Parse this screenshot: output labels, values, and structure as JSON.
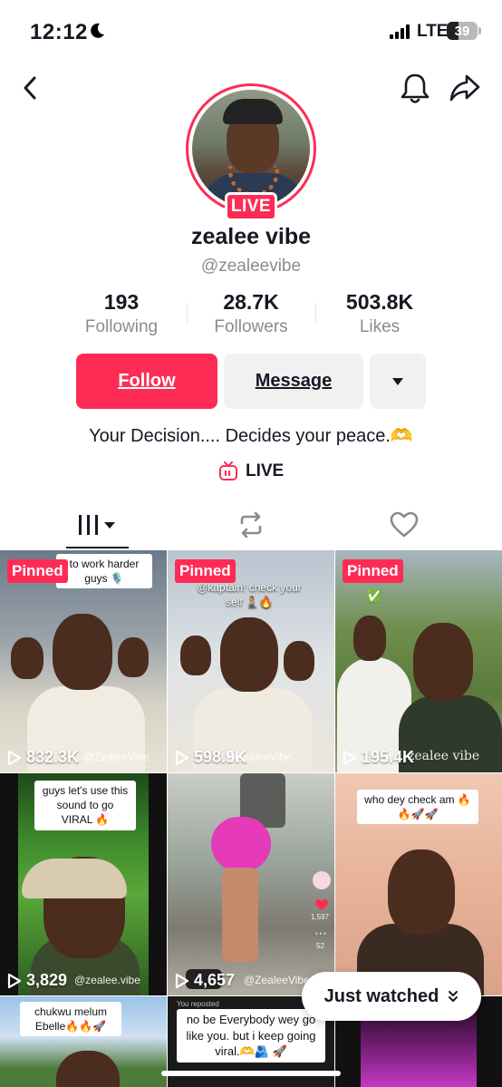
{
  "status_bar": {
    "time": "12:12",
    "network": "LTE",
    "battery": "39",
    "battery_level": 0.39
  },
  "nav": {
    "back_icon": "chevron-left-icon",
    "bell_icon": "bell-icon",
    "share_icon": "share-icon"
  },
  "profile": {
    "live_badge": "LIVE",
    "display_name": "zealee vibe",
    "username": "@zealeevibe",
    "stats": [
      {
        "value": "193",
        "label": "Following"
      },
      {
        "value": "28.7K",
        "label": "Followers"
      },
      {
        "value": "503.8K",
        "label": "Likes"
      }
    ],
    "follow_label": "Follow",
    "message_label": "Message",
    "bio": "Your Decision.... Decides your peace.🫶",
    "live_link": "LIVE"
  },
  "tabs": [
    {
      "icon": "videos-grid-icon"
    },
    {
      "icon": "repost-icon"
    },
    {
      "icon": "heart-icon"
    }
  ],
  "videos": [
    {
      "pinned": "Pinned",
      "caption": "to work harder guys 🎙️",
      "views": "832.3K",
      "watermark": "@ZealeeVibe"
    },
    {
      "pinned": "Pinned",
      "caption": "@kaptain! check your self 🧎🔥",
      "views": "598.9K",
      "watermark": "@ZealeeVibe"
    },
    {
      "pinned": "Pinned",
      "caption": "✅",
      "views": "195.4K",
      "watermark": "zealee vibe"
    },
    {
      "caption": "guys let's use this sound to go VIRAL 🔥",
      "views": "3,829",
      "watermark": "@zealee.vibe"
    },
    {
      "caption": "",
      "views": "4,657",
      "watermark": "@ZealeeVibe",
      "side_count_1": "1,597",
      "side_count_2": "52"
    },
    {
      "caption": "who dey check am 🔥🔥🚀🚀",
      "views": "",
      "watermark": ""
    },
    {
      "caption": "chukwu melum Ebelle🔥🔥🚀",
      "views": "",
      "watermark": ""
    },
    {
      "caption": "no be Everybody wey go like you. but i keep going viral.🫶🫂 🚀",
      "views": "",
      "watermark": ""
    },
    {
      "caption": "",
      "views": "",
      "watermark": ""
    }
  ],
  "you_reposted": "You reposted",
  "just_watched": "Just watched",
  "colors": {
    "brand_red": "#fe2c55",
    "secondary_bg": "#f1f1f2",
    "muted_text": "#8a8b91"
  }
}
